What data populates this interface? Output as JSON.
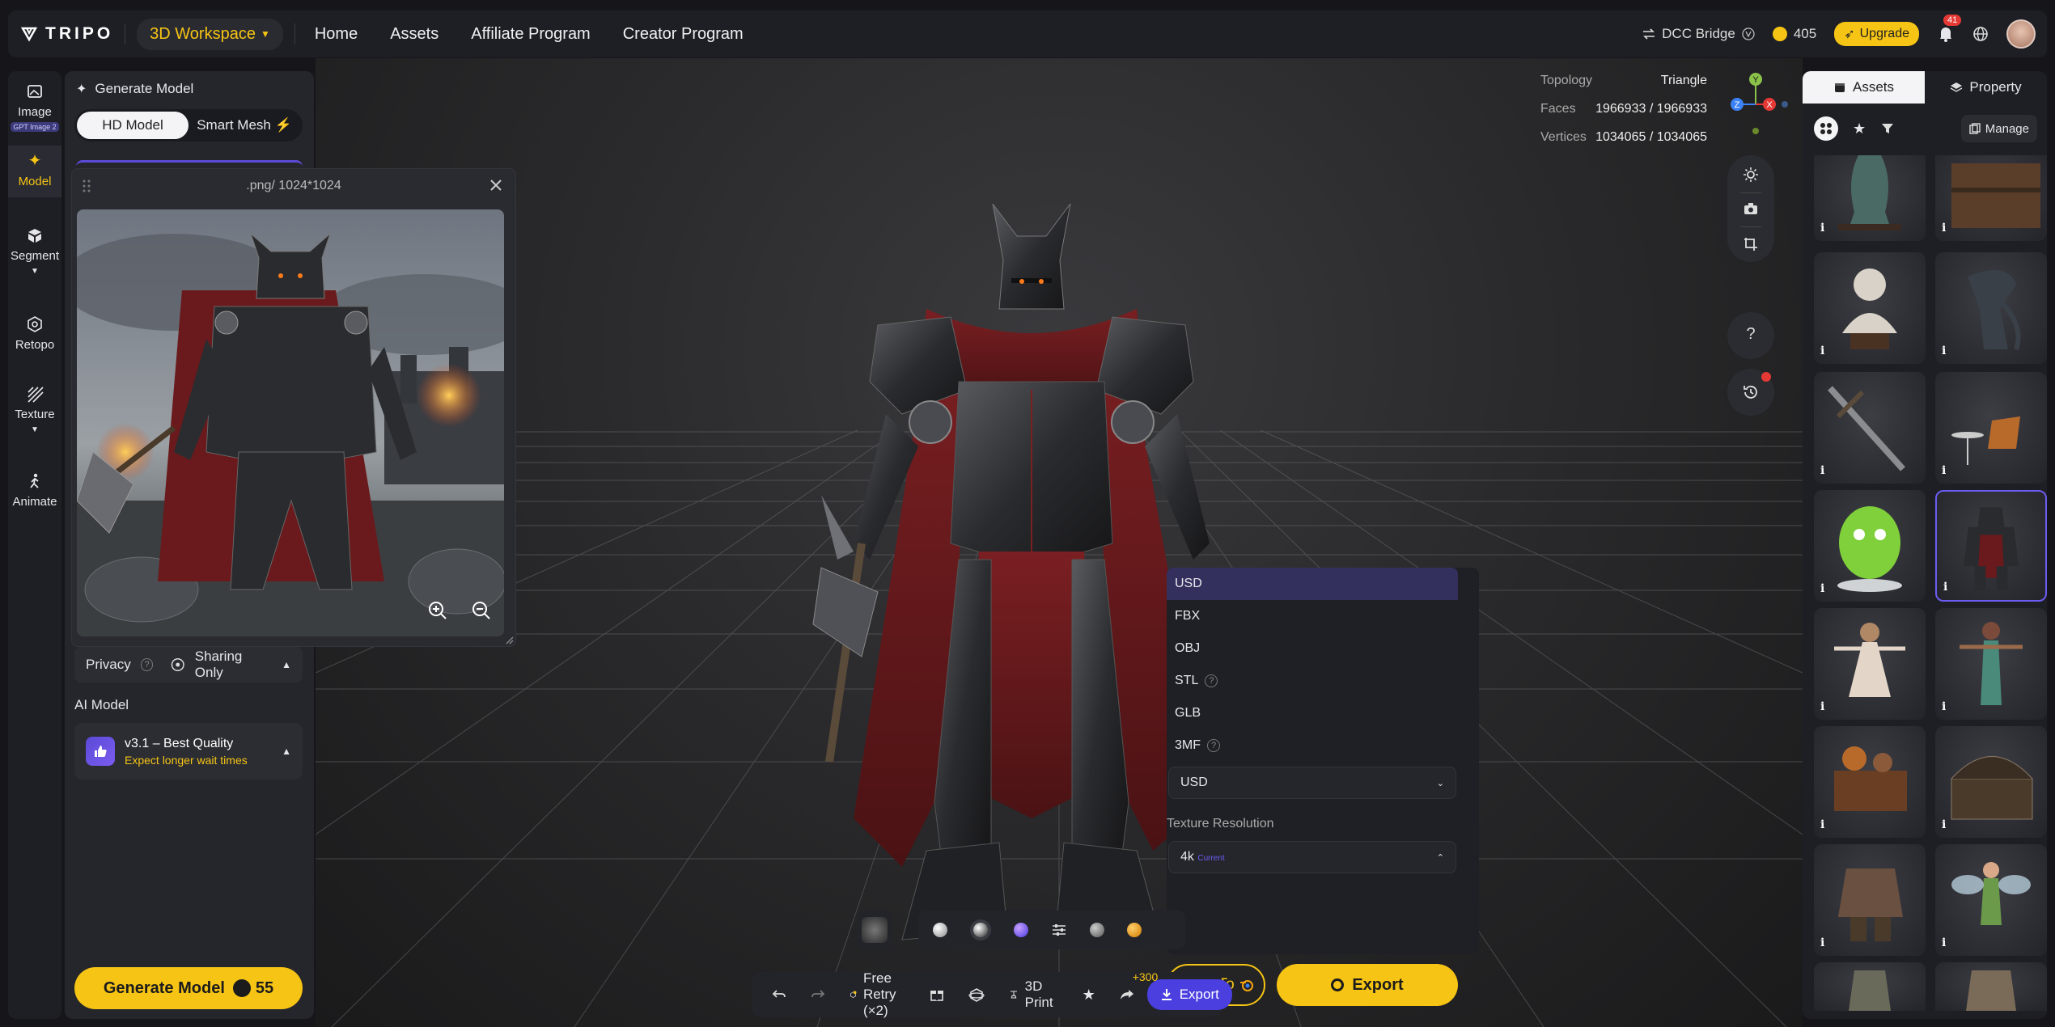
{
  "topbar": {
    "brand": "TRIPO",
    "workspace": "3D Workspace",
    "nav": [
      "Home",
      "Assets",
      "Affiliate Program",
      "Creator Program"
    ],
    "dcc_bridge": "DCC Bridge",
    "credits": "405",
    "upgrade": "Upgrade",
    "notification_count": "41"
  },
  "rail": {
    "items": [
      {
        "label": "Image",
        "tag": "GPT Image 2"
      },
      {
        "label": "Model"
      },
      {
        "label": "Segment"
      },
      {
        "label": "Retopo"
      },
      {
        "label": "Texture"
      },
      {
        "label": "Animate"
      }
    ]
  },
  "generate": {
    "title": "Generate Model",
    "mode_options": [
      "HD Model",
      "Smart Mesh"
    ],
    "privacy_label": "Privacy",
    "privacy_value": "Sharing Only",
    "ai_model_label": "AI Model",
    "ai_model_name": "v3.1 – Best Quality",
    "ai_model_note": "Expect longer wait times",
    "button_label": "Generate Model",
    "button_cost": "55"
  },
  "preview": {
    "title": ".png/ 1024*1024"
  },
  "stats": {
    "topology_label": "Topology",
    "topology_value": "Triangle",
    "faces_label": "Faces",
    "faces_value": "1966933 / 1966933",
    "vertices_label": "Vertices",
    "vertices_value": "1034065 / 1034065",
    "gizmo": {
      "y": "Y",
      "z": "Z",
      "x": "X"
    }
  },
  "export_menu": {
    "formats": [
      "USD",
      "FBX",
      "OBJ",
      "STL",
      "GLB",
      "3MF"
    ],
    "selected_format": "USD",
    "texture_resolution_label": "Texture Resolution",
    "texture_resolution_value": "4k",
    "texture_resolution_tag": "Current",
    "send_to": "Send To",
    "export": "Export"
  },
  "bottom_toolbar": {
    "free_retry": "Free Retry (×2)",
    "print": "3D Print",
    "plus": "+300",
    "export": "Export"
  },
  "assets_panel": {
    "tabs": [
      "Assets",
      "Property"
    ],
    "manage": "Manage",
    "info_glyph": "i"
  },
  "colors": {
    "accent_yellow": "#f6c414",
    "accent_purple": "#4b3fe0",
    "panel_bg": "#1e1f24"
  }
}
